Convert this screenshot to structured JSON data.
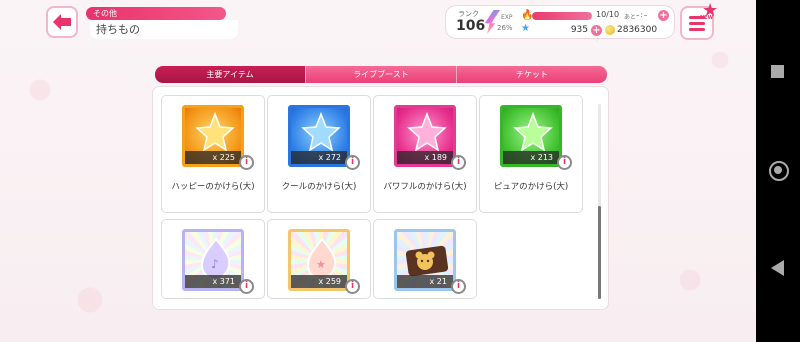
{
  "header": {
    "breadcrumb": "その他",
    "title": "持ちもの"
  },
  "status": {
    "rank_label": "ランク",
    "rank_value": "106",
    "exp_label": "EXP",
    "exp_percent": "26%",
    "lp_text": "10/10",
    "lp_fraction": 1.0,
    "lp_remaining_label": "あと",
    "lp_time": "–:–",
    "stars": "935",
    "coins": "2836300"
  },
  "menu": {
    "badge_text": "NEW"
  },
  "tabs": [
    {
      "label": "主要アイテム",
      "active": true
    },
    {
      "label": "ライブブースト",
      "active": false
    },
    {
      "label": "チケット",
      "active": false
    }
  ],
  "items": [
    {
      "name": "ハッピーのかけら(大)",
      "qty": "x 225",
      "theme": "orange"
    },
    {
      "name": "クールのかけら(大)",
      "qty": "x 272",
      "theme": "blue"
    },
    {
      "name": "パワフルのかけら(大)",
      "qty": "x 189",
      "theme": "pink"
    },
    {
      "name": "ピュアのかけら(大)",
      "qty": "x 213",
      "theme": "green"
    },
    {
      "name": "",
      "qty": "x 371",
      "theme": "rainbow1"
    },
    {
      "name": "",
      "qty": "x 259",
      "theme": "rainbow2"
    },
    {
      "name": "",
      "qty": "x 21",
      "theme": "rainbow3"
    }
  ],
  "icons": {
    "back": "back-arrow-icon",
    "menu": "hamburger-menu-icon",
    "flame": "flame-icon",
    "star": "star-icon",
    "coin": "coin-icon",
    "info": "info-icon"
  },
  "colors": {
    "accent": "#e8336b",
    "tab_active": "#b01a4c",
    "tab_inactive": "#f0588a"
  }
}
